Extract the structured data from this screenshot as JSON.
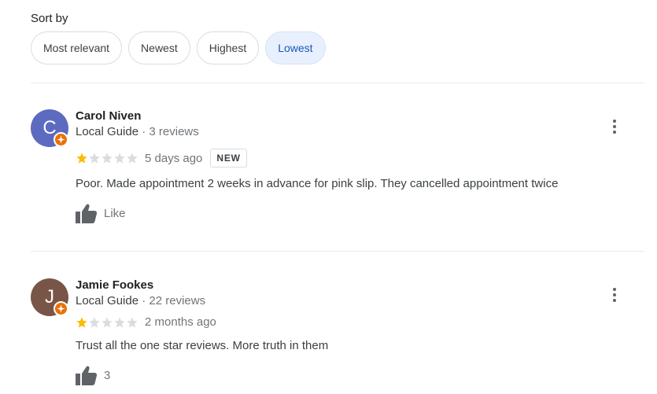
{
  "sort": {
    "label": "Sort by",
    "options": [
      "Most relevant",
      "Newest",
      "Highest",
      "Lowest"
    ],
    "selected": "Lowest"
  },
  "colors": {
    "star_filled": "#fbbc04",
    "star_empty": "#dadce0",
    "badge": "#e8710a",
    "accent": "#1a56b8"
  },
  "reviews": [
    {
      "initial": "C",
      "avatar_color": "#5c6bc0",
      "name": "Carol Niven",
      "guide": "Local Guide",
      "reviews": "· 3 reviews",
      "rating": 1,
      "time": "5 days ago",
      "badge": "NEW",
      "text": "Poor. Made appointment 2 weeks in advance for pink slip. They cancelled appointment twice",
      "like_label": "Like"
    },
    {
      "initial": "J",
      "avatar_color": "#795548",
      "name": "Jamie Fookes",
      "guide": "Local Guide",
      "reviews": "· 22 reviews",
      "rating": 1,
      "time": "2 months ago",
      "badge": "",
      "text": "Trust all the one star reviews. More truth in them",
      "like_label": "3"
    }
  ]
}
